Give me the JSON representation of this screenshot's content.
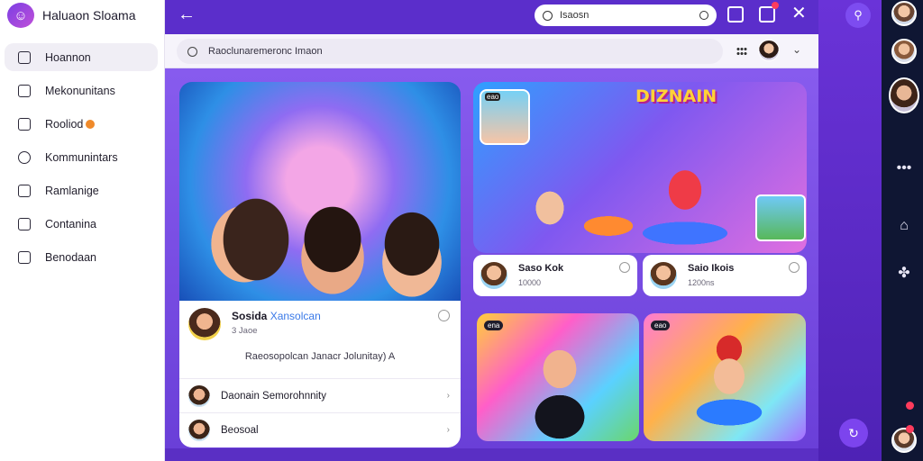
{
  "app": {
    "name": "Haluaon Sloama"
  },
  "sidebar": {
    "items": [
      {
        "label": "Hoannon",
        "icon": "home-icon",
        "active": true
      },
      {
        "label": "Mekonunitans",
        "icon": "edit-icon"
      },
      {
        "label": "Rooliod",
        "icon": "send-icon",
        "badge": true
      },
      {
        "label": "Kommunintars",
        "icon": "chat-icon"
      },
      {
        "label": "Ramlanige",
        "icon": "flag-icon"
      },
      {
        "label": "Contanina",
        "icon": "message-icon"
      },
      {
        "label": "Benodaan",
        "icon": "calendar-icon"
      }
    ]
  },
  "topbar": {
    "search_value": "Isaosn",
    "close": "✕",
    "back": "←"
  },
  "subbar": {
    "search_placeholder": "Raoclunaremeronc Imaon"
  },
  "hero": {
    "author": "Sosida",
    "author_highlight": "Xansolcan",
    "meta": "3 Jaoe",
    "description": "Raeosopolcan Janacr Jolunitay) A",
    "rows": [
      {
        "label": "Daonain Semorohnnity"
      },
      {
        "label": "Beosoal"
      }
    ]
  },
  "game": {
    "logo": "DIZNAIN",
    "thumb_badge": "eao"
  },
  "minis": [
    {
      "title": "Saso Kok",
      "meta": "10000"
    },
    {
      "title": "Saio Ikois",
      "meta": "1200ns"
    }
  ],
  "tiles": [
    {
      "badge": "ena"
    },
    {
      "badge": "eao"
    }
  ]
}
